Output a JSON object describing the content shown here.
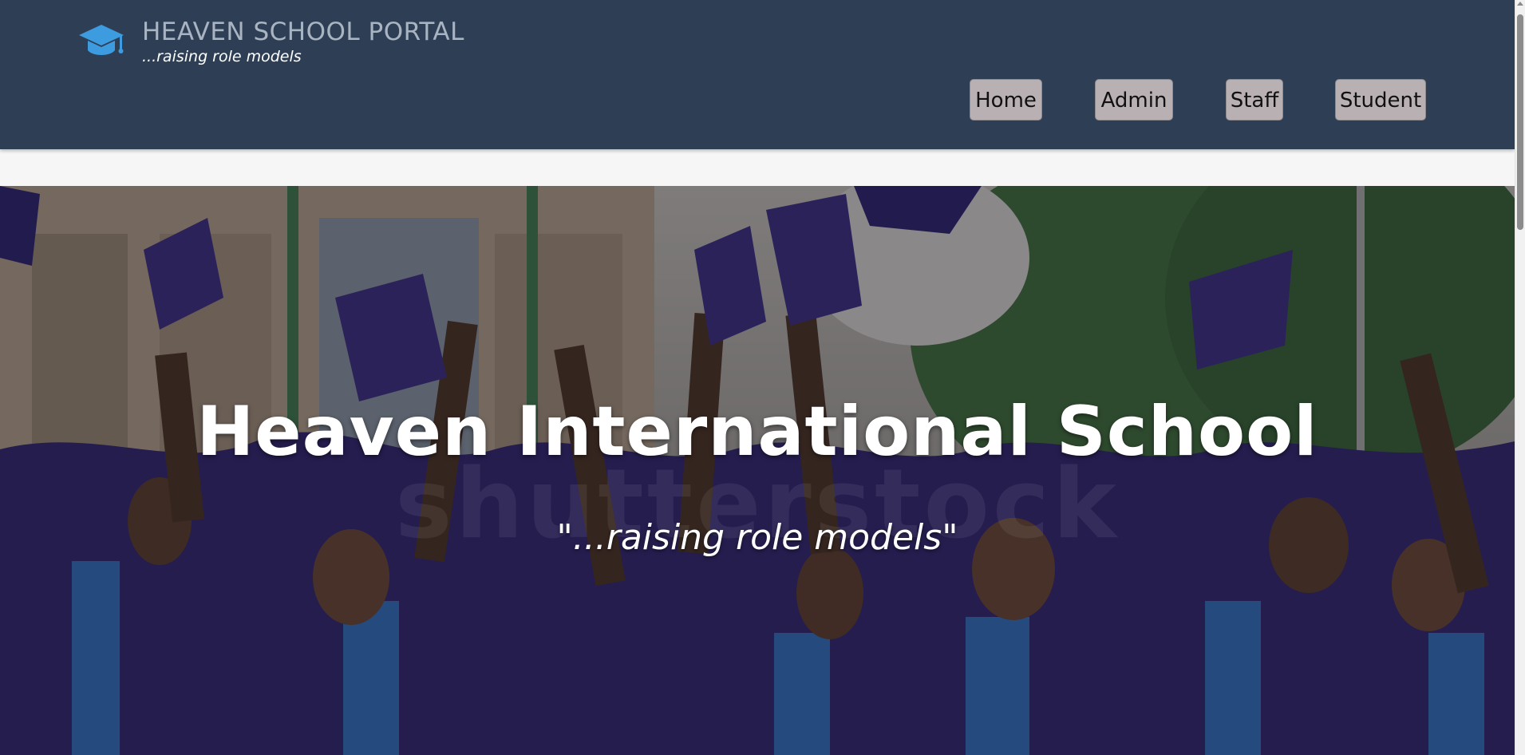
{
  "header": {
    "title": "HEAVEN SCHOOL PORTAL",
    "tagline": "...raising role models",
    "logo_icon": "graduation-cap-icon",
    "background_color": "#2e3f55",
    "logo_color": "#3d9be0"
  },
  "nav": {
    "items": [
      {
        "label": "Home"
      },
      {
        "label": "Admin"
      },
      {
        "label": "Staff"
      },
      {
        "label": "Student"
      }
    ],
    "button_color": "#b9b0b3"
  },
  "hero": {
    "title": "Heaven International School",
    "subtitle": "\"...raising role models\"",
    "watermark": "shutterstock"
  }
}
